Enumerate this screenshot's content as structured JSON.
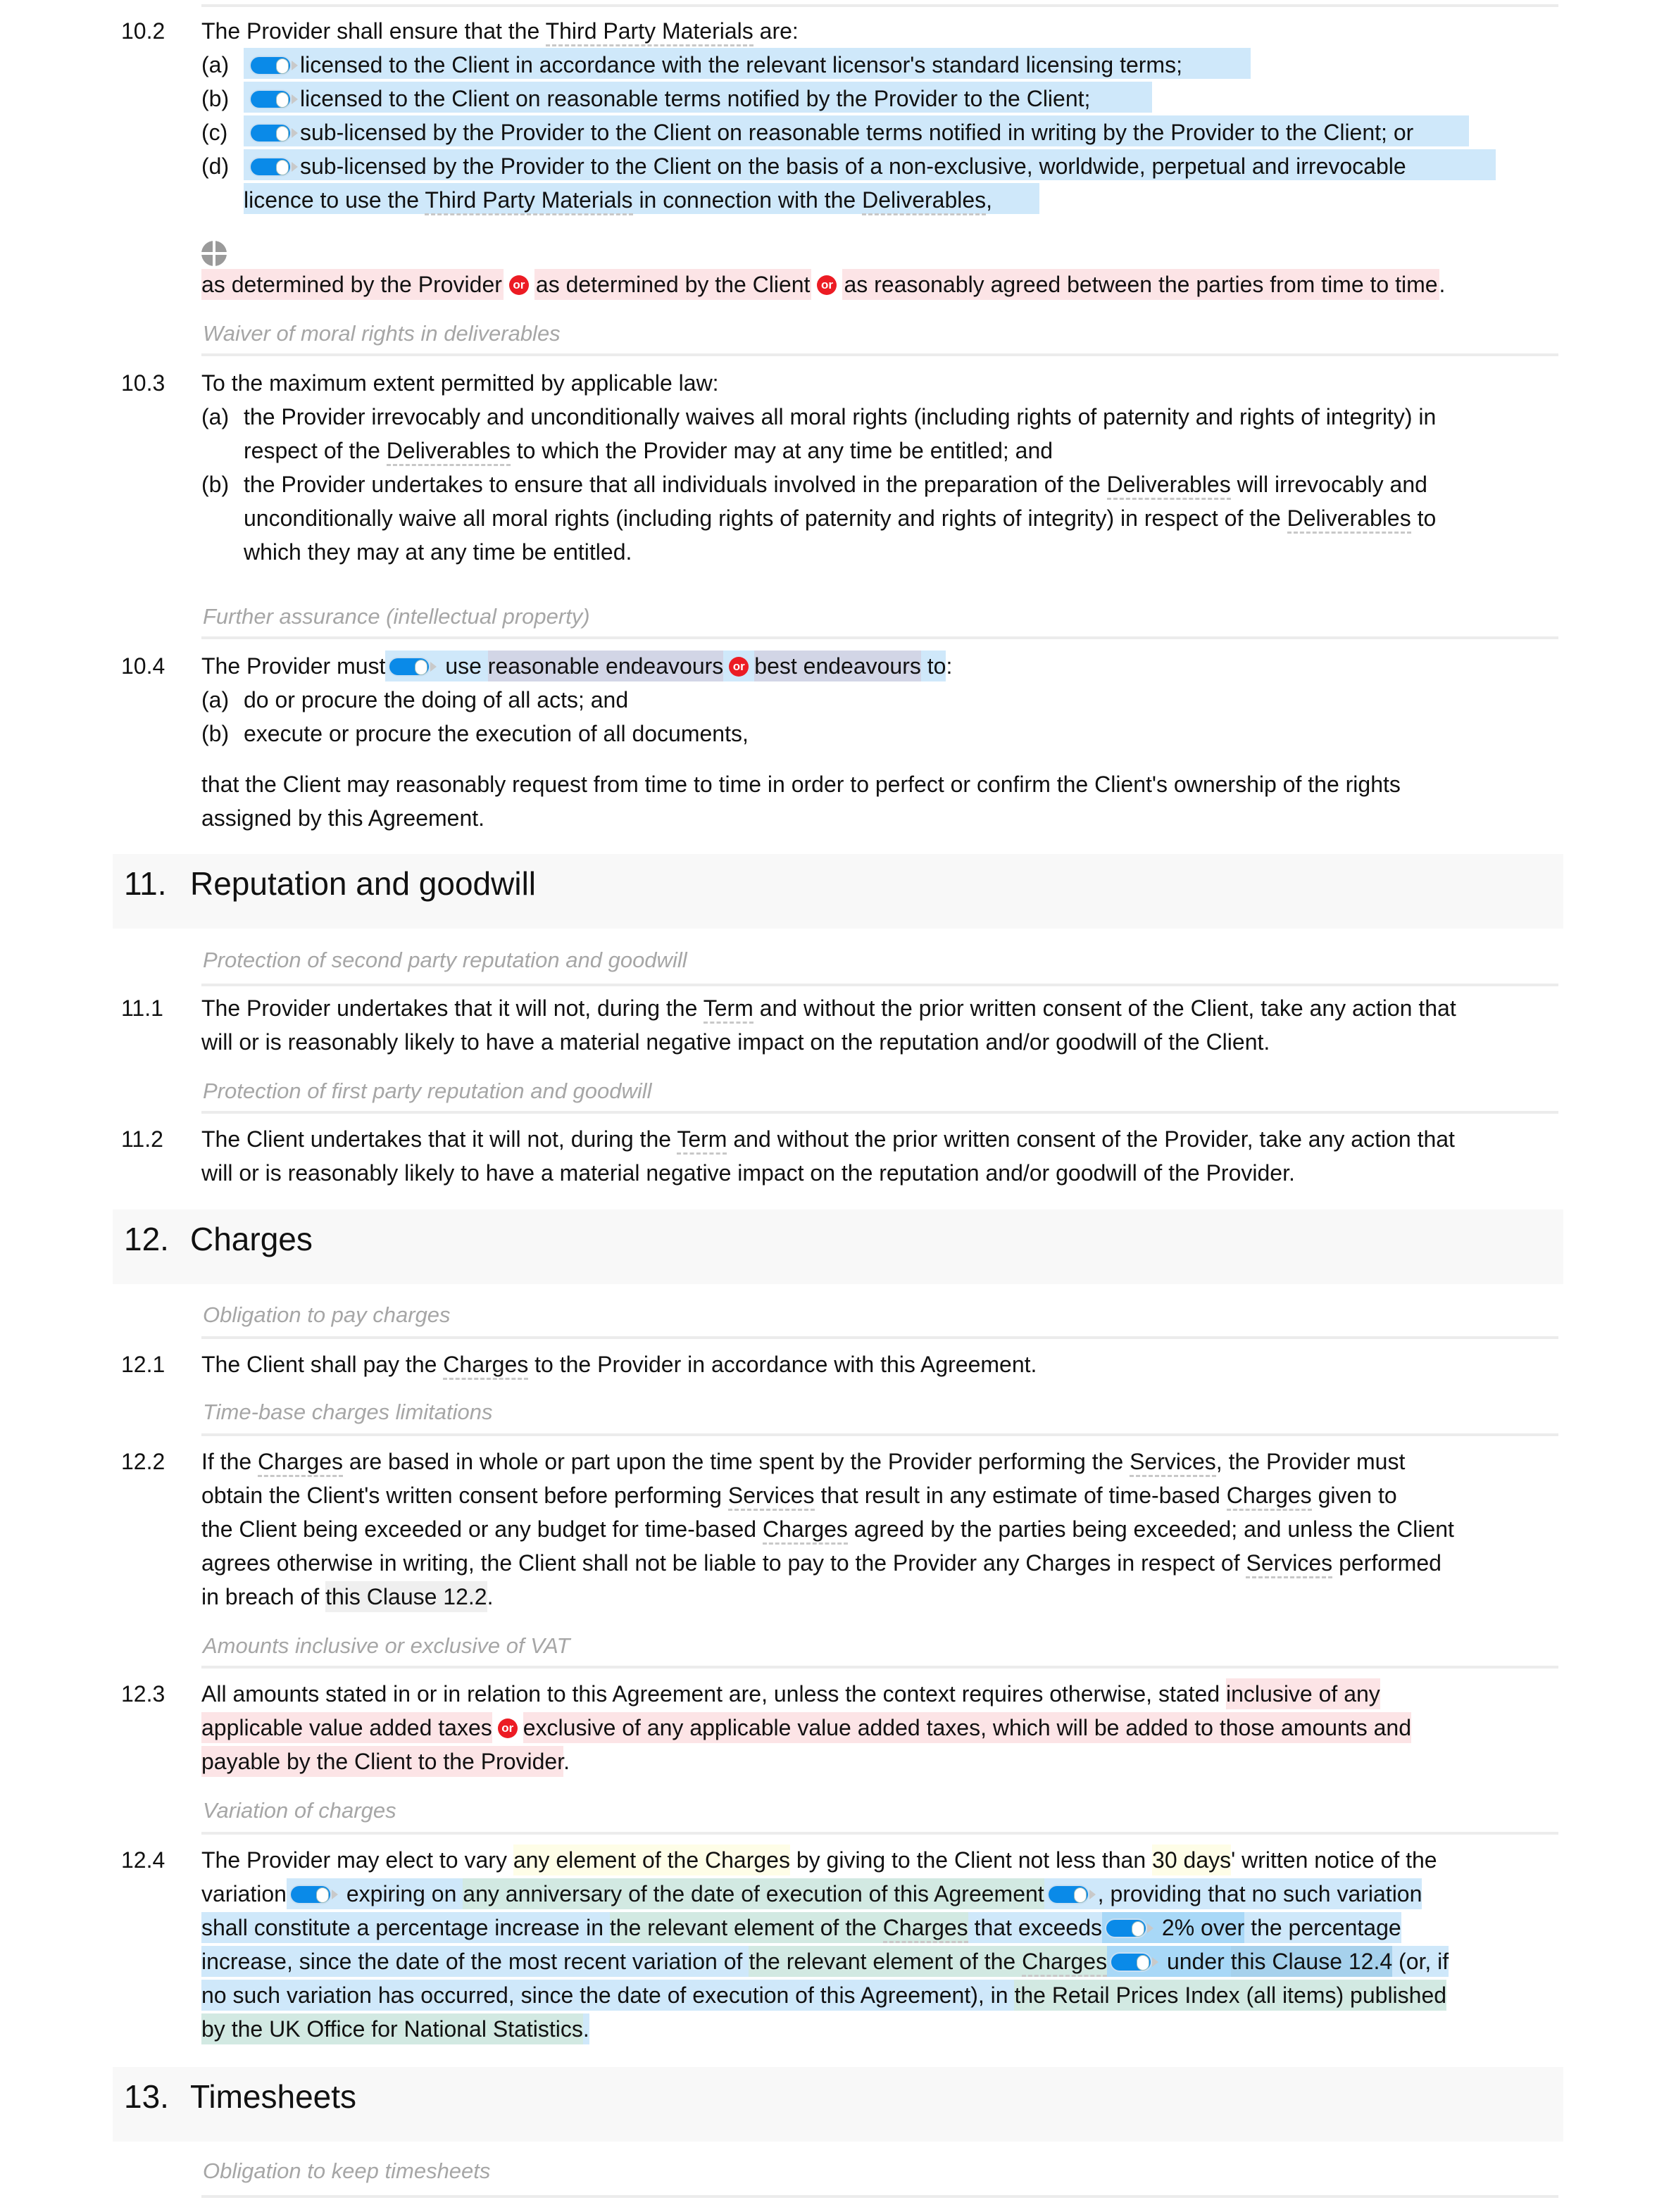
{
  "clause_10_2": {
    "number": "10.2",
    "intro_pre": "The Provider shall ensure that the ",
    "intro_term": "Third Party Materials",
    "intro_post": " are:",
    "items": [
      {
        "label": "(a)",
        "text": "licensed to the Client in accordance with the relevant licensor's standard licensing terms;",
        "enabled": true
      },
      {
        "label": "(b)",
        "text": "licensed to the Client on reasonable terms notified by the Provider to the Client;",
        "enabled": true
      },
      {
        "label": "(c)",
        "text": "sub-licensed by the Provider to the Client on reasonable terms notified in writing by the Provider to the Client",
        "suffix": "; or",
        "enabled": true
      },
      {
        "label": "(d)",
        "text": "sub-licensed by the Provider to the Client on the basis of a non-exclusive, worldwide, perpetual and irrevocable",
        "enabled": true
      }
    ],
    "d_cont_pre": "licence to use the ",
    "d_cont_term1": "Third Party Materials",
    "d_cont_mid": " in connection with the ",
    "d_cont_term2": "Deliverables",
    "d_cont_post": ",",
    "options": [
      "as determined by the Provider",
      "as determined by the Client",
      "as reasonably agreed between the parties from time to time"
    ],
    "options_end": ".",
    "or_label": "or"
  },
  "caption_10_3": "Waiver of moral rights in deliverables",
  "clause_10_3": {
    "number": "10.3",
    "intro": "To the maximum extent permitted by applicable law:",
    "a_label": "(a)",
    "a_line1": "the Provider irrevocably and unconditionally waives all moral rights (including rights of paternity and rights of integrity) in",
    "a_line2_pre": "respect of the ",
    "a_line2_term": "Deliverables",
    "a_line2_post": " to which the Provider may at any time be entitled; and",
    "b_label": "(b)",
    "b_line1_pre": "the Provider undertakes to ensure that all individuals involved in the preparation of the ",
    "b_line1_term": "Deliverables",
    "b_line1_post": " will irrevocably and",
    "b_line2_pre": "unconditionally waive all moral rights (including rights of paternity and rights of integrity) in respect of the ",
    "b_line2_term": "Deliverables",
    "b_line2_post": " to",
    "b_line3": "which they may at any time be entitled."
  },
  "caption_10_4": "Further assurance (intellectual property)",
  "clause_10_4": {
    "number": "10.4",
    "pre": "The Provider must",
    "use": " use ",
    "option1": "reasonable endeavours",
    "option2": "best endeavours",
    "post_hl": " to",
    "post": ":",
    "a_label": "(a)",
    "a_text": "do or procure the doing of all acts; and",
    "b_label": "(b)",
    "b_text": "execute or procure the execution of all documents,",
    "tail1": "that the Client may reasonably request from time to time in order to perfect or confirm the Client's ownership of the rights",
    "tail2": "assigned by this Agreement."
  },
  "section_11": {
    "number": "11.",
    "title": "Reputation and goodwill"
  },
  "caption_11_1": "Protection of second party reputation and goodwill",
  "clause_11_1": {
    "number": "11.1",
    "line1_pre": "The Provider undertakes that it will not, during the ",
    "line1_term": "Term",
    "line1_post": " and without the prior written consent of the Client, take any action that",
    "line2": "will or is reasonably likely to have a material negative impact on the reputation and/or goodwill of the Client."
  },
  "caption_11_2": "Protection of first party reputation and goodwill",
  "clause_11_2": {
    "number": "11.2",
    "line1_pre": "The Client undertakes that it will not, during the ",
    "line1_term": "Term",
    "line1_post": " and without the prior written consent of the Provider, take any action that",
    "line2": "will or is reasonably likely to have a material negative impact on the reputation and/or goodwill of the Provider."
  },
  "section_12": {
    "number": "12.",
    "title": "Charges"
  },
  "caption_12_1": "Obligation to pay charges",
  "clause_12_1": {
    "number": "12.1",
    "pre": "The Client shall pay the ",
    "term": "Charges",
    "post": " to the Provider in accordance with this Agreement."
  },
  "caption_12_2": "Time-base charges limitations",
  "clause_12_2": {
    "number": "12.2",
    "l1a": "If the ",
    "l1t1": "Charges",
    "l1b": " are based in whole or part upon the time spent by the Provider performing the ",
    "l1t2": "Services",
    "l1c": ", the Provider must",
    "l2a": "obtain the Client's written consent before performing ",
    "l2t1": "Services",
    "l2b": " that result in any estimate of time-based ",
    "l2t2": "Charges",
    "l2c": " given to",
    "l3a": "the Client being exceeded or any budget for time-based ",
    "l3t1": "Charges",
    "l3b": " agreed by the parties being exceeded; and unless the Client",
    "l4a": "agrees otherwise in writing, the Client shall not be liable to pay to the Provider any Charges in respect of ",
    "l4t1": "Services",
    "l4b": " performed",
    "l5a": "in breach of ",
    "l5ref": "this Clause 12.2",
    "l5b": "."
  },
  "caption_12_3": "Amounts inclusive or exclusive of VAT",
  "clause_12_3": {
    "number": "12.3",
    "l1a": "All amounts stated in or in relation to this Agreement are, unless the context requires otherwise, stated ",
    "l1opt": "inclusive of any",
    "l2opt1": "applicable value added taxes",
    "l2opt2": "exclusive of any applicable value added taxes, which will be added to those amounts and",
    "l3opt": "payable by the Client to the Provider",
    "l3end": "."
  },
  "caption_12_4": "Variation of charges",
  "clause_12_4": {
    "number": "12.4",
    "l1a": "The Provider may elect to vary ",
    "l1y1": "any element of the Charges",
    "l1b": " by giving to the Client not less than ",
    "l1y2": "30 days",
    "l1c": "' written notice of the",
    "l2a": "variation",
    "l2b": " expiring on ",
    "l2g": "any anniversary of the date of execution of this Agreement",
    "l2c": ", providing that no such variation",
    "l3a": "shall constitute a percentage increase in ",
    "l3g": "the relevant element of the ",
    "l3gt": "Charges",
    "l3b": " that exceeds",
    "l3c": " 2% over",
    "l3d": " the percentage",
    "l4a": "increase, since the date of the most recent variation of ",
    "l4g": "the relevant element of the ",
    "l4gt": "Charges",
    "l4b": " under ",
    "l4ref": "this Clause 12.4",
    "l4c": " (or, if",
    "l5a": "no such variation has occurred, since the date of execution of this Agreement), in ",
    "l5g": "the Retail Prices Index (all items) published",
    "l6g": "by the UK Office for National Statistics",
    "l6end": "."
  },
  "section_13": {
    "number": "13.",
    "title": "Timesheets"
  },
  "caption_13_1": "Obligation to keep timesheets"
}
